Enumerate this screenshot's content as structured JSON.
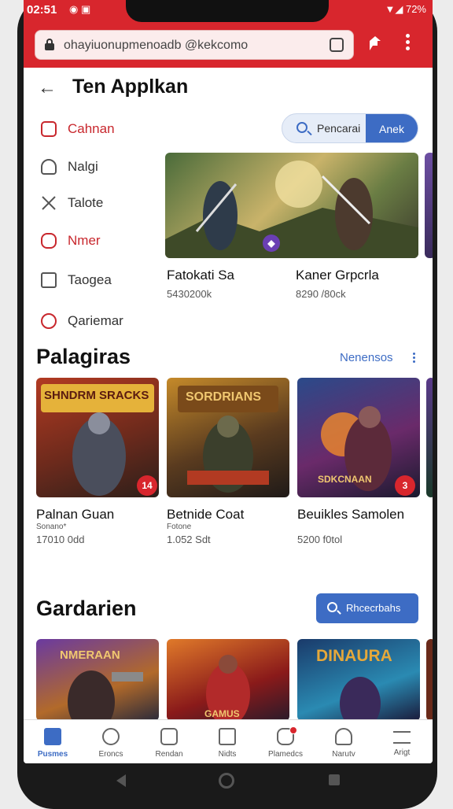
{
  "status": {
    "time": "02:51",
    "right": "▼◢ 72%"
  },
  "browser": {
    "url": "ohayiuonupmenoadb @kekcomo"
  },
  "header": {
    "back": "←",
    "title": "Ten Applkan"
  },
  "sidebar": {
    "items": [
      {
        "label": "Cahnan",
        "active": true
      },
      {
        "label": "Nalgi",
        "active": false
      },
      {
        "label": "Talote",
        "active": false
      },
      {
        "label": "Nmer",
        "active": true
      },
      {
        "label": "Taogea",
        "active": false
      },
      {
        "label": "Qariemar",
        "active": false
      }
    ]
  },
  "search": {
    "label": "Pencarai",
    "button": "Anek"
  },
  "featured": [
    {
      "title": "Fatokati Sa",
      "sub": "5430200k"
    },
    {
      "title": "Kaner Grpcrla",
      "sub": "8290 /80ck"
    }
  ],
  "sections": {
    "popular": {
      "title": "Palagiras",
      "more": "Nenensos",
      "items": [
        {
          "title": "Palnan Guan",
          "meta": "Sonano*",
          "sub": "17010 0dd",
          "badge": "14",
          "art": "SHNDRM SRACKS"
        },
        {
          "title": "Betnide Coat",
          "meta": "Fotone",
          "sub": "1.052 Sdt",
          "badge": "",
          "art": "SORDRIANS"
        },
        {
          "title": "Beuikles Samolen",
          "meta": "",
          "sub": "5200 f0tol",
          "badge": "3",
          "art": "SDKCNAAN"
        }
      ]
    },
    "garden": {
      "title": "Gardarien",
      "button": "Rhcecrbahs",
      "items": [
        {
          "art": "NMERAAN"
        },
        {
          "art": "GAMUS"
        },
        {
          "art": "DINAURA"
        }
      ]
    }
  },
  "bottomnav": [
    {
      "label": "Pusmes",
      "active": true
    },
    {
      "label": "Eroncs",
      "active": false
    },
    {
      "label": "Rendan",
      "active": false
    },
    {
      "label": "Nidts",
      "active": false
    },
    {
      "label": "Plamedcs",
      "active": false
    },
    {
      "label": "Narutv",
      "active": false
    },
    {
      "label": "Arigt",
      "active": false
    }
  ],
  "colors": {
    "brand_red": "#d8262d",
    "accent_blue": "#3d6cc4"
  }
}
